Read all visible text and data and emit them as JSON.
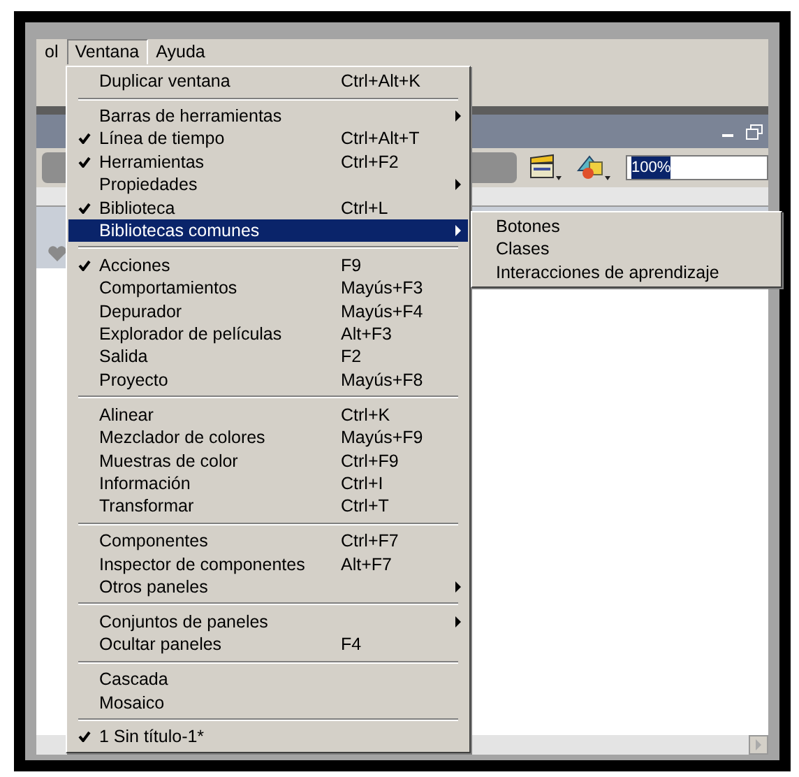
{
  "menubar": [
    {
      "label": "ol",
      "selected": false
    },
    {
      "label": "Ventana",
      "selected": true
    },
    {
      "label": "Ayuda",
      "selected": false
    }
  ],
  "zoom_field": {
    "value": "100%",
    "text_selected": true
  },
  "menu": {
    "sections": [
      [
        {
          "label": "Duplicar ventana",
          "shortcut": "Ctrl+Alt+K",
          "checked": false,
          "has_submenu": false,
          "selected": false
        }
      ],
      [
        {
          "label": "Barras de herramientas",
          "checked": false,
          "has_submenu": true,
          "selected": false
        },
        {
          "label": "Línea de tiempo",
          "shortcut": "Ctrl+Alt+T",
          "checked": true,
          "has_submenu": false,
          "selected": false
        },
        {
          "label": "Herramientas",
          "shortcut": "Ctrl+F2",
          "checked": true,
          "has_submenu": false,
          "selected": false
        },
        {
          "label": "Propiedades",
          "checked": false,
          "has_submenu": true,
          "selected": false
        },
        {
          "label": "Biblioteca",
          "shortcut": "Ctrl+L",
          "checked": true,
          "has_submenu": false,
          "selected": false
        },
        {
          "label": "Bibliotecas comunes",
          "checked": false,
          "has_submenu": true,
          "selected": true
        }
      ],
      [
        {
          "label": "Acciones",
          "shortcut": "F9",
          "checked": true,
          "has_submenu": false,
          "selected": false
        },
        {
          "label": "Comportamientos",
          "shortcut": "Mayús+F3",
          "checked": false,
          "has_submenu": false,
          "selected": false
        },
        {
          "label": "Depurador",
          "shortcut": "Mayús+F4",
          "checked": false,
          "has_submenu": false,
          "selected": false
        },
        {
          "label": "Explorador de películas",
          "shortcut": "Alt+F3",
          "checked": false,
          "has_submenu": false,
          "selected": false
        },
        {
          "label": "Salida",
          "shortcut": "F2",
          "checked": false,
          "has_submenu": false,
          "selected": false
        },
        {
          "label": "Proyecto",
          "shortcut": "Mayús+F8",
          "checked": false,
          "has_submenu": false,
          "selected": false
        }
      ],
      [
        {
          "label": "Alinear",
          "shortcut": "Ctrl+K",
          "checked": false,
          "has_submenu": false,
          "selected": false
        },
        {
          "label": "Mezclador de colores",
          "shortcut": "Mayús+F9",
          "checked": false,
          "has_submenu": false,
          "selected": false
        },
        {
          "label": "Muestras de color",
          "shortcut": "Ctrl+F9",
          "checked": false,
          "has_submenu": false,
          "selected": false
        },
        {
          "label": "Información",
          "shortcut": "Ctrl+I",
          "checked": false,
          "has_submenu": false,
          "selected": false
        },
        {
          "label": "Transformar",
          "shortcut": "Ctrl+T",
          "checked": false,
          "has_submenu": false,
          "selected": false
        }
      ],
      [
        {
          "label": "Componentes",
          "shortcut": "Ctrl+F7",
          "checked": false,
          "has_submenu": false,
          "selected": false
        },
        {
          "label": "Inspector de componentes",
          "shortcut": "Alt+F7",
          "checked": false,
          "has_submenu": false,
          "selected": false
        },
        {
          "label": "Otros paneles",
          "checked": false,
          "has_submenu": true,
          "selected": false
        }
      ],
      [
        {
          "label": "Conjuntos de paneles",
          "checked": false,
          "has_submenu": true,
          "selected": false
        },
        {
          "label": "Ocultar paneles",
          "shortcut": "F4",
          "checked": false,
          "has_submenu": false,
          "selected": false
        }
      ],
      [
        {
          "label": "Cascada",
          "checked": false,
          "has_submenu": false,
          "selected": false
        },
        {
          "label": "Mosaico",
          "checked": false,
          "has_submenu": false,
          "selected": false
        }
      ],
      [
        {
          "label": "1 Sin título-1*",
          "checked": true,
          "has_submenu": false,
          "selected": false
        }
      ]
    ]
  },
  "submenu": {
    "items": [
      {
        "label": "Botones"
      },
      {
        "label": "Clases"
      },
      {
        "label": "Interacciones de aprendizaje"
      }
    ]
  }
}
